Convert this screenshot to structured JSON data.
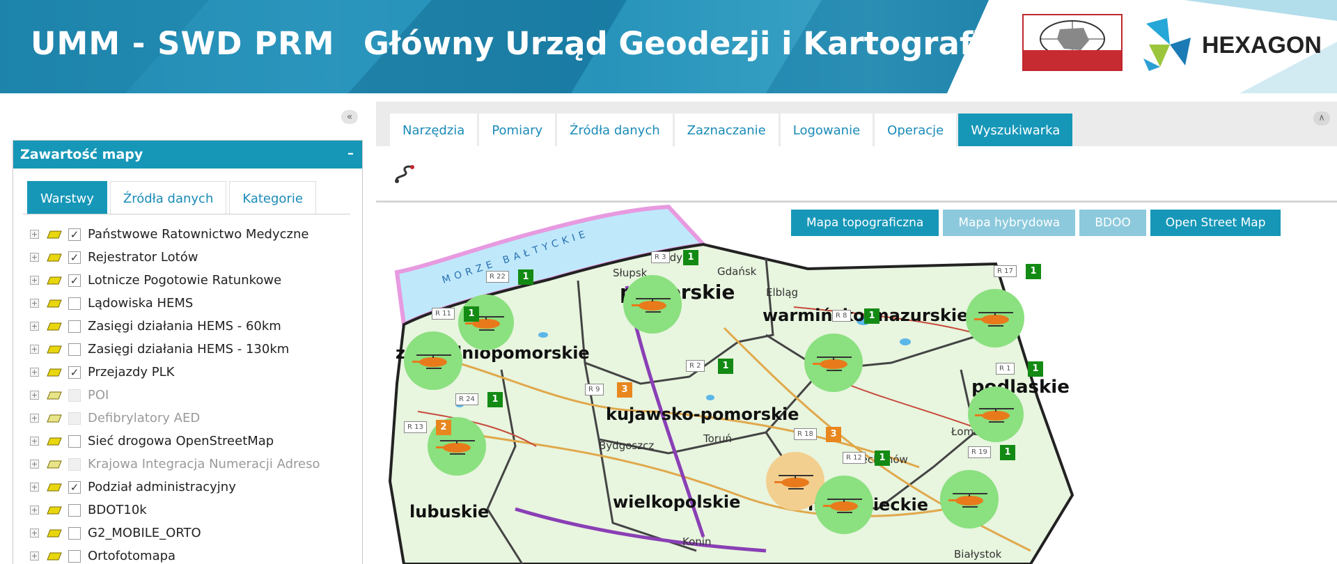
{
  "header": {
    "title_left": "UMM - SWD PRM",
    "title_right": "Główny Urząd Geodezji i Kartografii",
    "logo_gugik": "gugik-logo",
    "logo_hexagon_text": "HEXAGON"
  },
  "left_panel": {
    "box_title": "Zawartość mapy",
    "collapse_icon": "«",
    "box_minimize": "–",
    "tabs": [
      {
        "label": "Warstwy",
        "active": true
      },
      {
        "label": "Źródła danych",
        "active": false
      },
      {
        "label": "Kategorie",
        "active": false
      }
    ],
    "layers": [
      {
        "label": "Państwowe Ratownictwo Medyczne",
        "checked": true,
        "disabled": false
      },
      {
        "label": "Rejestrator Lotów",
        "checked": true,
        "disabled": false
      },
      {
        "label": "Lotnicze Pogotowie Ratunkowe",
        "checked": true,
        "disabled": false
      },
      {
        "label": "Lądowiska HEMS",
        "checked": false,
        "disabled": false
      },
      {
        "label": "Zasięgi działania HEMS - 60km",
        "checked": false,
        "disabled": false
      },
      {
        "label": "Zasięgi działania HEMS - 130km",
        "checked": false,
        "disabled": false
      },
      {
        "label": "Przejazdy PLK",
        "checked": true,
        "disabled": false
      },
      {
        "label": "POI",
        "checked": false,
        "disabled": true
      },
      {
        "label": "Defibrylatory AED",
        "checked": false,
        "disabled": true
      },
      {
        "label": "Sieć drogowa OpenStreetMap",
        "checked": false,
        "disabled": false
      },
      {
        "label": "Krajowa Integracja Numeracji Adreso",
        "checked": false,
        "disabled": true
      },
      {
        "label": "Podział administracyjny",
        "checked": true,
        "disabled": false
      },
      {
        "label": "BDOT10k",
        "checked": false,
        "disabled": false
      },
      {
        "label": "G2_MOBILE_ORTO",
        "checked": false,
        "disabled": false
      },
      {
        "label": "Ortofotomapa",
        "checked": false,
        "disabled": false
      }
    ]
  },
  "top_tabs": [
    {
      "label": "Narzędzia",
      "active": false
    },
    {
      "label": "Pomiary",
      "active": false
    },
    {
      "label": "Źródła danych",
      "active": false
    },
    {
      "label": "Zaznaczanie",
      "active": false
    },
    {
      "label": "Logowanie",
      "active": false
    },
    {
      "label": "Operacje",
      "active": false
    },
    {
      "label": "Wyszukiwarka",
      "active": true
    }
  ],
  "basemaps": [
    {
      "label": "Mapa topograficzna",
      "active": true
    },
    {
      "label": "Mapa hybrydowa",
      "active": false
    },
    {
      "label": "BDOO",
      "active": false
    },
    {
      "label": "Open Street Map",
      "active": true
    }
  ],
  "map": {
    "sea_label": "MORZE BAŁTYCKIE",
    "regions": [
      {
        "label": "pomorskie",
        "font": 28
      },
      {
        "label": "warmińsko-mazurskie",
        "font": 24
      },
      {
        "label": "zachodniopomorskie",
        "font": 24
      },
      {
        "label": "kujawsko-pomorskie",
        "font": 24
      },
      {
        "label": "podlaskie",
        "font": 26
      },
      {
        "label": "lubuskie",
        "font": 24
      },
      {
        "label": "wielkopolskie",
        "font": 24
      },
      {
        "label": "mazowieckie",
        "font": 24
      }
    ],
    "cities": [
      "Gdynia",
      "Gdańsk",
      "Słupsk",
      "Elbląg",
      "Bydgoszcz",
      "Toruń",
      "Łomża",
      "Ciechanów",
      "Konin",
      "Białystok"
    ],
    "markers": [
      {
        "callout": "R 3",
        "badge": "1",
        "kind": "green"
      },
      {
        "callout": "R 22",
        "badge": "1",
        "kind": "green"
      },
      {
        "callout": "R 17",
        "badge": "1",
        "kind": "green"
      },
      {
        "callout": "R 11",
        "badge": "1",
        "kind": "green"
      },
      {
        "callout": "R 8",
        "badge": "1",
        "kind": "green"
      },
      {
        "callout": "R 2",
        "badge": "1",
        "kind": "green"
      },
      {
        "callout": "R 1",
        "badge": "1",
        "kind": "green"
      },
      {
        "callout": "R 9",
        "badge": "3",
        "kind": "orange"
      },
      {
        "callout": "R 24",
        "badge": "1",
        "kind": "green"
      },
      {
        "callout": "R 13",
        "badge": "2",
        "kind": "orange"
      },
      {
        "callout": "R 18",
        "badge": "3",
        "kind": "orange"
      },
      {
        "callout": "R 12",
        "badge": "1",
        "kind": "green"
      },
      {
        "callout": "R 19",
        "badge": "1",
        "kind": "green"
      }
    ]
  },
  "colors": {
    "accent": "#1697b8",
    "accent_light": "#8cc9dc",
    "green_cluster": "#8be07f",
    "orange_cluster": "#f3cf8f",
    "badge_green": "#138a14",
    "badge_orange": "#e8871e"
  }
}
